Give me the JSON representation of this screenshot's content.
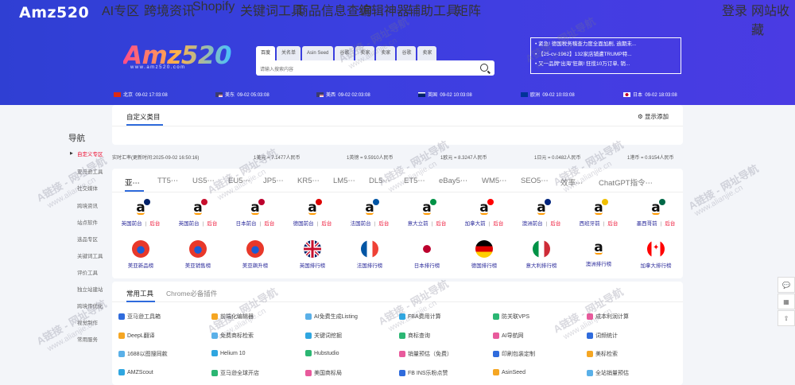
{
  "header": {
    "brand": "Amz520",
    "nav": [
      "AI专区",
      "跨境资讯",
      "Shopify",
      "关键词工具",
      "商品信息查询",
      "编辑神器",
      "辅助工具",
      "矩阵"
    ],
    "login": "登录",
    "favorite": "网站收藏"
  },
  "logo": {
    "text": "Amz520",
    "sub": "www.amz520.com"
  },
  "search": {
    "tabs": [
      "百度",
      "关名单",
      "Asin Seed",
      "谷歌",
      "卖家",
      "卖家",
      "谷歌",
      "卖家"
    ],
    "placeholder": "请输入搜索内容"
  },
  "news": [
    "紧急! 德国税务稽查力度全面加剧, 逾期未...",
    "【25-cv-1962】132家店铺遭TRUMP特...",
    "又一品牌“出海”狂飙! 狂揽10万订单, 销..."
  ],
  "clocks": [
    {
      "city": "北京",
      "time": "09-02 17:03:08"
    },
    {
      "city": "美东",
      "time": "09-02 05:03:08"
    },
    {
      "city": "美西",
      "time": "09-02 02:03:08"
    },
    {
      "city": "英国",
      "time": "09-02 10:03:08"
    },
    {
      "city": "欧洲",
      "time": "09-02 10:03:08"
    },
    {
      "city": "日本",
      "time": "09-02 18:03:08"
    }
  ],
  "sidebar": {
    "title": "导航",
    "items": [
      "自定义专区",
      "亚马逊工具",
      "社交媒体",
      "跨境资讯",
      "站点软件",
      "选品专区",
      "关键词工具",
      "评价工具",
      "独立站建站",
      "跨境传优化",
      "视觉制作",
      "常用服务"
    ]
  },
  "custom": {
    "title": "自定义类目",
    "show_add": "显示添加"
  },
  "rates": [
    "实时汇率(更新时间:2025-09-02 16:50:16)",
    "1美元 = 7.1477人民币",
    "1英镑 = 9.5910人民币",
    "1欧元 = 8.3247人民币",
    "1日元 = 0.0482人民币",
    "1港币 = 0.9154人民币"
  ],
  "platform_tabs": [
    "亚⋯",
    "TT5⋯",
    "US5⋯",
    "EU5⋯",
    "JP5⋯",
    "KR5⋯",
    "LM5⋯",
    "DL5⋯",
    "ET5⋯",
    "eBay5⋯",
    "WM5⋯",
    "SEO5⋯",
    "效率⋯",
    "ChatGPT指令⋯"
  ],
  "markets": [
    {
      "front": "英国前台",
      "back": "后台"
    },
    {
      "front": "英国前台",
      "back": "后台"
    },
    {
      "front": "日本前台",
      "back": "后台"
    },
    {
      "front": "德国前台",
      "back": "后台"
    },
    {
      "front": "法国前台",
      "back": "后台"
    },
    {
      "front": "意大立前",
      "back": "后台"
    },
    {
      "front": "加拿大前",
      "back": "后台"
    },
    {
      "front": "澳洲前台",
      "back": "后台"
    },
    {
      "front": "西班牙前",
      "back": "后台"
    },
    {
      "front": "墨西哥前",
      "back": "后台"
    }
  ],
  "rankings": [
    "美亚新品榜",
    "美亚销售榜",
    "美亚飙升榜",
    "英国排行榜",
    "法国排行榜",
    "日本排行榜",
    "德国排行榜",
    "意大利排行榜",
    "澳洲排行榜",
    "加拿大排行榜"
  ],
  "tools_tabs": [
    "常用工具",
    "Chrome必备插件"
  ],
  "tools": [
    [
      "亚马逊工具箱",
      "前端化编辑器",
      "AI免费生成Listing",
      "FBA费用计算",
      "防关联VPS",
      "成本利润计算"
    ],
    [
      "DeepL翻译",
      "免费商标检索",
      "关键词挖掘",
      "商标查询",
      "AI导航网",
      "词频统计"
    ],
    [
      "1688以图搜同款",
      "Helium 10",
      "Hubstudio",
      "销量预估（免费）",
      "印刷包装定制",
      "美标检索"
    ],
    [
      "AMZScout",
      "亚马逊全球开店",
      "美国商标局",
      "FB INS乐粉点赞",
      "AsinSeed",
      "全站销量预估"
    ]
  ],
  "watermark": {
    "a": "A链接 - 网址导航",
    "b": "www.alianjie.cn"
  }
}
